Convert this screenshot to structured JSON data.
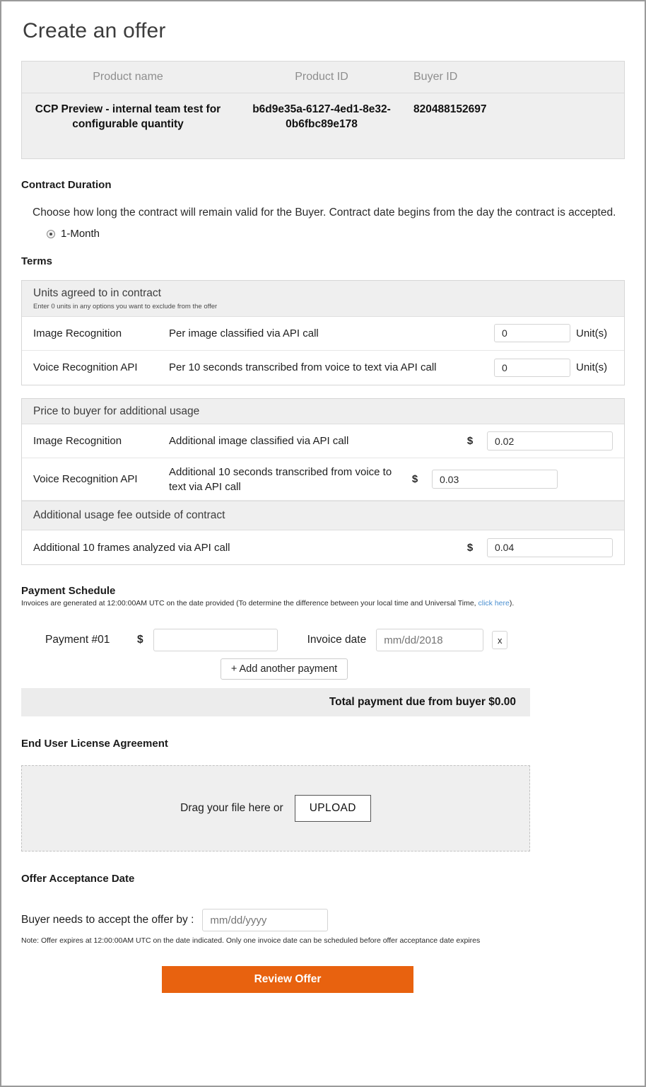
{
  "page": {
    "title": "Create an offer"
  },
  "product_table": {
    "headers": [
      "Product name",
      "Product ID",
      "Buyer ID"
    ],
    "row": {
      "product_name": "CCP Preview - internal team test for configurable quantity",
      "product_id": "b6d9e35a-6127-4ed1-8e32-0b6fbc89e178",
      "buyer_id": "820488152697"
    }
  },
  "contract_duration": {
    "heading": "Contract Duration",
    "description": "Choose how long the contract will remain valid for the Buyer. Contract date begins from the day the contract is accepted.",
    "options": [
      {
        "label": "1-Month",
        "selected": true
      }
    ]
  },
  "terms": {
    "heading": "Terms",
    "units_panel": {
      "title": "Units agreed to in contract",
      "subtitle": "Enter 0 units in any options you want to exclude from the offer",
      "rows": [
        {
          "name": "Image Recognition",
          "description": "Per image classified via API call",
          "value": "0",
          "suffix": "Unit(s)"
        },
        {
          "name": "Voice Recognition API",
          "description": "Per 10 seconds transcribed from voice to text via API call",
          "value": "0",
          "suffix": "Unit(s)"
        }
      ]
    },
    "price_panel": {
      "title": "Price to buyer for additional usage",
      "currency_symbol": "$",
      "rows": [
        {
          "name": "Image Recognition",
          "description": "Additional image classified via API call",
          "value": "0.02"
        },
        {
          "name": "Voice Recognition API",
          "description": "Additional 10 seconds transcribed from voice to text via API call",
          "value": "0.03"
        }
      ],
      "outside_title": "Additional usage fee outside of contract",
      "outside_rows": [
        {
          "description": "Additional 10 frames analyzed via API call",
          "value": "0.04"
        }
      ]
    }
  },
  "payment_schedule": {
    "heading": "Payment Schedule",
    "note_prefix": "Invoices are generated at 12:00:00AM UTC on the date provided (To determine the difference between your local time and Universal Time, ",
    "note_link": "click here",
    "note_suffix": ").",
    "row": {
      "label": "Payment #01",
      "currency_symbol": "$",
      "amount_value": "",
      "amount_placeholder": "",
      "invoice_label": "Invoice date",
      "invoice_value": "",
      "invoice_placeholder": "mm/dd/2018",
      "remove_label": "x"
    },
    "add_button": "+ Add another payment",
    "total_text": "Total payment due from buyer $0.00"
  },
  "eula": {
    "heading": "End User License Agreement",
    "drag_text": "Drag your file here or",
    "upload_button": "UPLOAD"
  },
  "offer_acceptance": {
    "heading": "Offer Acceptance Date",
    "label": "Buyer needs to accept the offer by :",
    "date_value": "",
    "date_placeholder": "mm/dd/yyyy",
    "note": "Note: Offer expires at 12:00:00AM UTC on the date indicated. Only one invoice date can be scheduled before offer acceptance date expires"
  },
  "actions": {
    "review_offer": "Review Offer",
    "accent_color": "#e8620f"
  }
}
